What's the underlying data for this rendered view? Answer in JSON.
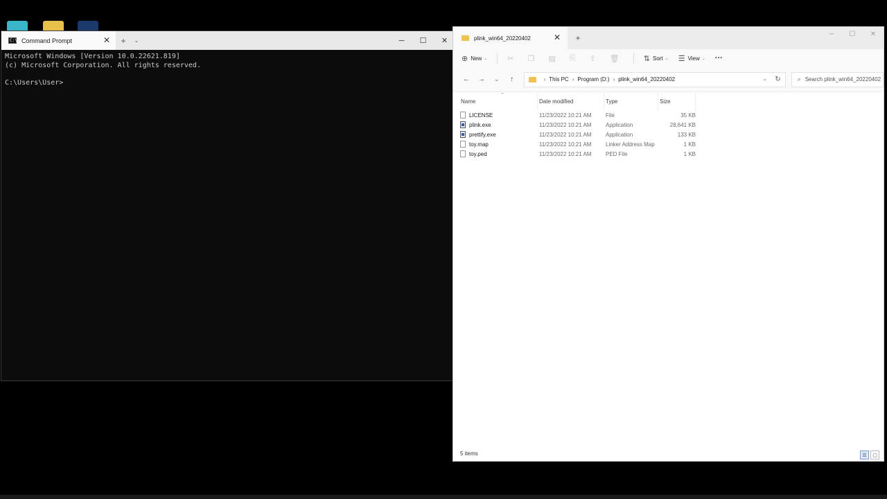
{
  "terminal": {
    "tab_title": "Command Prompt",
    "icon_glyph": "C:\\_",
    "close_tab": "✕",
    "new_tab": "+",
    "dropdown": "⌄",
    "minimize": "─",
    "maximize": "☐",
    "close": "✕",
    "lines": [
      "Microsoft Windows [Version 10.0.22621.819]",
      "(c) Microsoft Corporation. All rights reserved.",
      "",
      "C:\\Users\\User>"
    ]
  },
  "explorer": {
    "tab_title": "plink_win64_20220402",
    "close_tab": "✕",
    "new_tab": "+",
    "minimize": "─",
    "maximize": "☐",
    "close": "✕",
    "toolbar": {
      "new_label": "New",
      "sort_label": "Sort",
      "view_label": "View",
      "more_label": "···"
    },
    "nav": {
      "back": "←",
      "forward": "→",
      "recent": "⌄",
      "up": "↑"
    },
    "breadcrumb": [
      "This PC",
      "Program (D:)",
      "plink_win64_20220402"
    ],
    "search_placeholder": "Search plink_win64_20220402",
    "columns": {
      "name": "Name",
      "date": "Date modified",
      "type": "Type",
      "size": "Size"
    },
    "files": [
      {
        "name": "LICENSE",
        "date": "11/23/2022 10:21 AM",
        "type": "File",
        "size": "35 KB",
        "icon": "file-icon"
      },
      {
        "name": "plink.exe",
        "date": "11/23/2022 10:21 AM",
        "type": "Application",
        "size": "28,641 KB",
        "icon": "app-icon"
      },
      {
        "name": "prettify.exe",
        "date": "11/23/2022 10:21 AM",
        "type": "Application",
        "size": "133 KB",
        "icon": "app-icon"
      },
      {
        "name": "toy.map",
        "date": "11/23/2022 10:21 AM",
        "type": "Linker Address Map",
        "size": "1 KB",
        "icon": "file-icon"
      },
      {
        "name": "toy.ped",
        "date": "11/23/2022 10:21 AM",
        "type": "PED File",
        "size": "1 KB",
        "icon": "file-icon"
      }
    ],
    "status": "5 items"
  }
}
